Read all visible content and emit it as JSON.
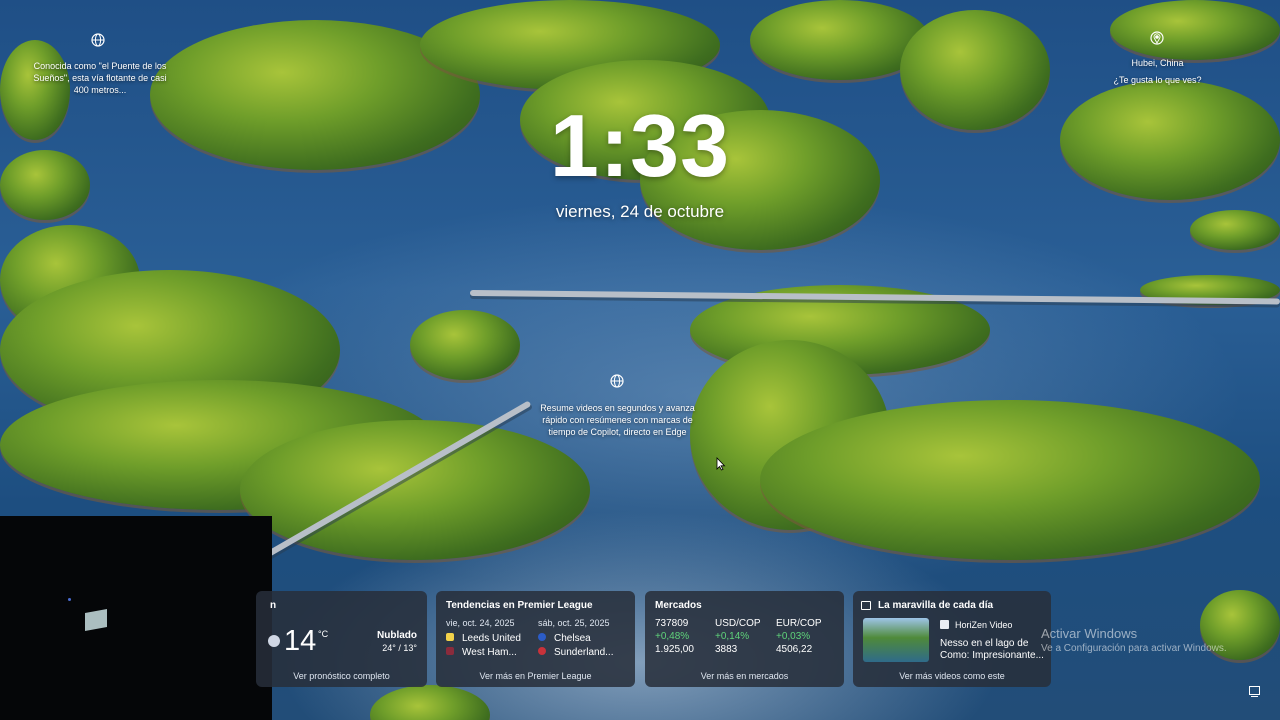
{
  "clock": {
    "time": "1:33",
    "date": "viernes, 24 de octubre"
  },
  "spotlight_left": {
    "icon": "globe-icon",
    "text": "Conocida como \"el Puente de los Sueños\", esta vía flotante de casi 400 metros..."
  },
  "spotlight_location": {
    "icon": "location-pin-icon",
    "place": "Hubei, China",
    "question": "¿Te gusta lo que ves?"
  },
  "spotlight_center": {
    "icon": "globe-icon",
    "text": "Resume videos en segundos y avanza rápido con resúmenes con marcas de tiempo de Copilot, directo en Edge"
  },
  "weather": {
    "temp": "14",
    "unit": "°C",
    "condition": "Nublado",
    "range": "24° / 13°",
    "footer": "Ver pronóstico completo",
    "partial_title": "n"
  },
  "premier": {
    "title": "Tendencias en Premier League",
    "match1": {
      "date": "vie, oct. 24, 2025",
      "home": "Leeds United",
      "away": "West Ham..."
    },
    "match2": {
      "date": "sáb, oct. 25, 2025",
      "home": "Chelsea",
      "away": "Sunderland..."
    },
    "footer": "Ver más en Premier League"
  },
  "markets": {
    "title": "Mercados",
    "items": [
      {
        "label": "737809",
        "change": "+0,48%",
        "value": "1.925,00"
      },
      {
        "label": "USD/COP",
        "change": "+0,14%",
        "value": "3883"
      },
      {
        "label": "EUR/COP",
        "change": "+0,03%",
        "value": "4506,22"
      }
    ],
    "footer": "Ver más en mercados"
  },
  "video": {
    "title": "La maravilla de cada día",
    "source": "HoriZen Video",
    "headline": "Nesso en el lago de Como: Impresionante...",
    "footer": "Ver más videos como este"
  },
  "activate": {
    "line1": "Activar Windows",
    "line2": "Ve a Configuración para activar Windows."
  },
  "colors": {
    "card_bg": "#282e3a",
    "positive": "#5fd37a"
  }
}
